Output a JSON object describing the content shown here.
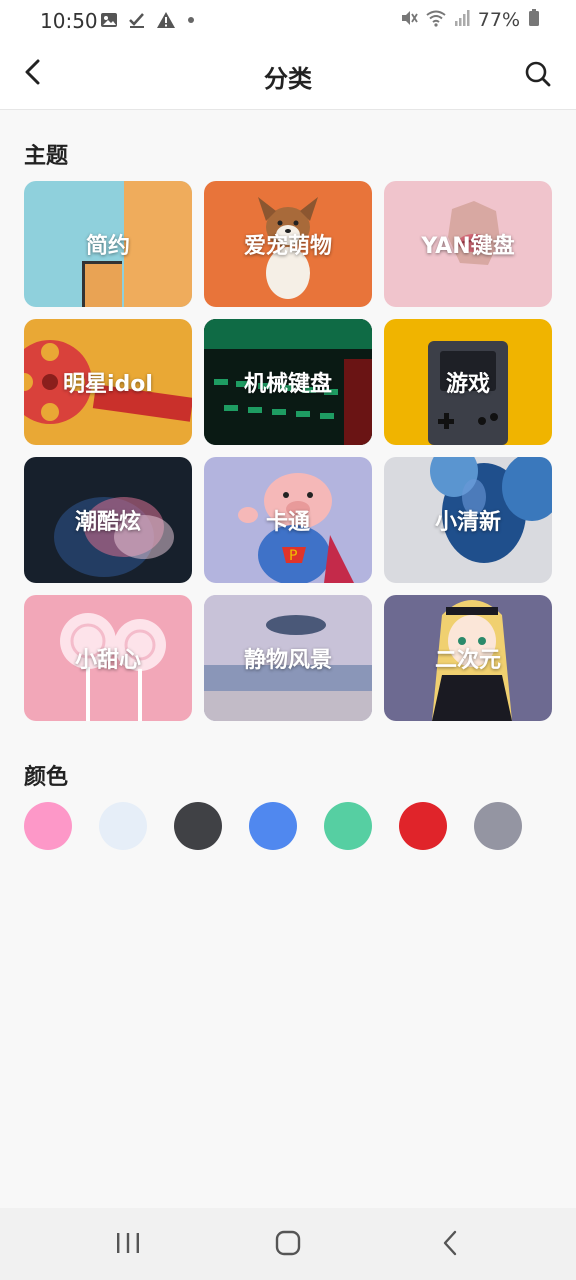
{
  "status_bar": {
    "time": "10:50",
    "battery": "77%",
    "left_icons": [
      "image-icon",
      "check-download-icon",
      "warning-icon",
      "dot-icon"
    ],
    "right_icons": [
      "mute-icon",
      "wifi-icon",
      "signal-icon",
      "battery-icon"
    ]
  },
  "header": {
    "title": "分类",
    "back_icon": "chevron-left-icon",
    "search_icon": "search-icon"
  },
  "themes": {
    "section_title": "主题",
    "items": [
      {
        "label": "简约",
        "color": "#8fd0dc"
      },
      {
        "label": "爱宠萌物",
        "color": "#e8743a"
      },
      {
        "label": "YAN键盘",
        "color": "#f0c4cc"
      },
      {
        "label": "明星idol",
        "color": "#e9a835"
      },
      {
        "label": "机械键盘",
        "color": "#0f3a2a"
      },
      {
        "label": "游戏",
        "color": "#f0b400"
      },
      {
        "label": "潮酷炫",
        "color": "#17202c"
      },
      {
        "label": "卡通",
        "color": "#b3b4de"
      },
      {
        "label": "小清新",
        "color": "#d9dadf"
      },
      {
        "label": "小甜心",
        "color": "#f2a7b8"
      },
      {
        "label": "静物风景",
        "color": "#bcb7cf"
      },
      {
        "label": "二次元",
        "color": "#6d6a91"
      }
    ]
  },
  "colors": {
    "section_title": "颜色",
    "swatches": [
      "#fd98c8",
      "#e6eef8",
      "#404145",
      "#5088ef",
      "#56cfa2",
      "#e0242a",
      "#9495a2"
    ]
  },
  "nav_bar": {
    "icons": [
      "recents-icon",
      "home-icon",
      "back-icon"
    ]
  }
}
